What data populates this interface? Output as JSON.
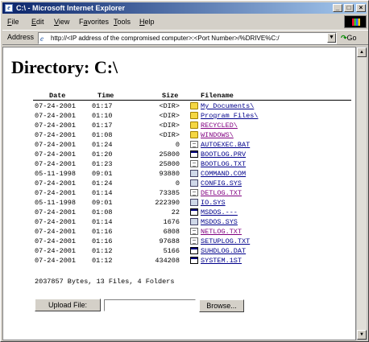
{
  "window": {
    "title": "C:\\ - Microsoft Internet Explorer"
  },
  "menu": [
    "File",
    "Edit",
    "View",
    "Favorites",
    "Tools",
    "Help"
  ],
  "menu_access_keys": [
    "F",
    "E",
    "V",
    "a",
    "T",
    "H"
  ],
  "address": {
    "label": "Address",
    "url": "http://<IP address of the compromised computer>:<Port Number>/%DRIVE%C:/",
    "go_label": "Go"
  },
  "page": {
    "heading": "Directory: C:\\",
    "columns": {
      "date": "Date",
      "time": "Time",
      "size": "Size",
      "name": "Filename"
    },
    "files": [
      {
        "date": "07-24-2001",
        "time": "01:17",
        "size": "<DIR>",
        "name": "My Documents\\",
        "type": "folder",
        "visited": false
      },
      {
        "date": "07-24-2001",
        "time": "01:10",
        "size": "<DIR>",
        "name": "Program Files\\",
        "type": "folder",
        "visited": false
      },
      {
        "date": "07-24-2001",
        "time": "01:17",
        "size": "<DIR>",
        "name": "RECYCLED\\",
        "type": "folder",
        "visited": true
      },
      {
        "date": "07-24-2001",
        "time": "01:08",
        "size": "<DIR>",
        "name": "WINDOWS\\",
        "type": "folder",
        "visited": true
      },
      {
        "date": "07-24-2001",
        "time": "01:24",
        "size": "0",
        "name": "AUTOEXEC.BAT",
        "type": "txt",
        "visited": false
      },
      {
        "date": "07-24-2001",
        "time": "01:20",
        "size": "25800",
        "name": "BOOTLOG.PRV",
        "type": "exe",
        "visited": false
      },
      {
        "date": "07-24-2001",
        "time": "01:23",
        "size": "25800",
        "name": "BOOTLOG.TXT",
        "type": "txt",
        "visited": false
      },
      {
        "date": "05-11-1998",
        "time": "09:01",
        "size": "93880",
        "name": "COMMAND.COM",
        "type": "sys",
        "visited": false
      },
      {
        "date": "07-24-2001",
        "time": "01:24",
        "size": "0",
        "name": "CONFIG.SYS",
        "type": "sys",
        "visited": false
      },
      {
        "date": "07-24-2001",
        "time": "01:14",
        "size": "73385",
        "name": "DETLOG.TXT",
        "type": "txt",
        "visited": true
      },
      {
        "date": "05-11-1998",
        "time": "09:01",
        "size": "222390",
        "name": "IO.SYS",
        "type": "sys",
        "visited": false
      },
      {
        "date": "07-24-2001",
        "time": "01:08",
        "size": "22",
        "name": "MSDOS.---",
        "type": "exe",
        "visited": false
      },
      {
        "date": "07-24-2001",
        "time": "01:14",
        "size": "1676",
        "name": "MSDOS.SYS",
        "type": "sys",
        "visited": false
      },
      {
        "date": "07-24-2001",
        "time": "01:16",
        "size": "6808",
        "name": "NETLOG.TXT",
        "type": "txt",
        "visited": true
      },
      {
        "date": "07-24-2001",
        "time": "01:16",
        "size": "97688",
        "name": "SETUPLOG.TXT",
        "type": "txt",
        "visited": false
      },
      {
        "date": "07-24-2001",
        "time": "01:12",
        "size": "5166",
        "name": "SUHDLOG.DAT",
        "type": "exe",
        "visited": false
      },
      {
        "date": "07-24-2001",
        "time": "01:12",
        "size": "434208",
        "name": "SYSTEM.1ST",
        "type": "exe",
        "visited": false
      }
    ],
    "summary": "2037857 Bytes, 13 Files, 4 Folders",
    "upload_button": "Upload File:",
    "upload_field_value": "",
    "browse_button": "Browse..."
  },
  "colors": {
    "link": "#00008b",
    "visited_link": "#800080",
    "titlebar_start": "#0a246a",
    "titlebar_end": "#a6caf0"
  }
}
